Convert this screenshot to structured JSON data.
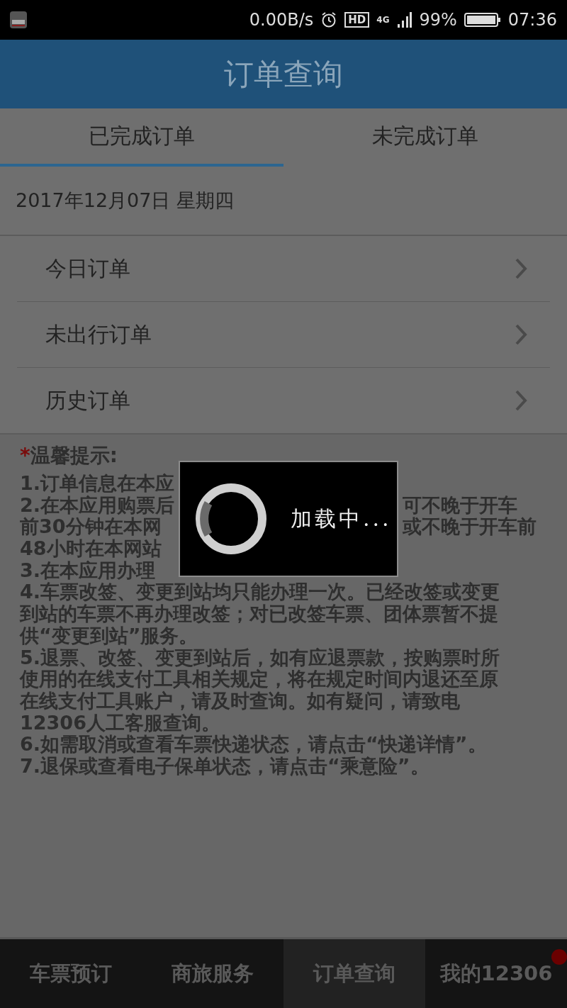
{
  "status_bar": {
    "speed": "0.00B/s",
    "hd": "HD",
    "network": "4G",
    "battery": "99%",
    "time": "07:36"
  },
  "header": {
    "title": "订单查询"
  },
  "tabs": [
    {
      "label": "已完成订单",
      "selected": true
    },
    {
      "label": "未完成订单",
      "selected": false
    }
  ],
  "date": "2017年12月07日 星期四",
  "menu": [
    {
      "label": "今日订单"
    },
    {
      "label": "未出行订单"
    },
    {
      "label": "历史订单"
    }
  ],
  "notice": {
    "mark": "*",
    "title": "温馨提示:",
    "lines": [
      {
        "kind": "split",
        "left": "1.订单信息在本应"
      },
      {
        "kind": "split",
        "left": "2.在本应用购票后",
        "right": "可不晚于开车"
      },
      {
        "kind": "split",
        "left": "前30分钟在本网",
        "right": "或不晚于开车前"
      },
      {
        "kind": "split",
        "left": "48小时在本网站"
      },
      {
        "kind": "split",
        "left": "3.在本应用办理"
      },
      {
        "kind": "full",
        "text": "4.车票改签、变更到站均只能办理一次。已经改签或变更"
      },
      {
        "kind": "full",
        "text": "到站的车票不再办理改签；对已改签车票、团体票暂不提"
      },
      {
        "kind": "full",
        "text": "供“变更到站”服务。"
      },
      {
        "kind": "full",
        "text": "5.退票、改签、变更到站后，如有应退票款，按购票时所"
      },
      {
        "kind": "full",
        "text": "使用的在线支付工具相关规定，将在规定时间内退还至原"
      },
      {
        "kind": "full",
        "text": "在线支付工具账户，请及时查询。如有疑问，请致电"
      },
      {
        "kind": "full",
        "text": "12306人工客服查询。"
      },
      {
        "kind": "full",
        "text": "6.如需取消或查看车票快递状态，请点击“快递详情”。"
      },
      {
        "kind": "full",
        "text": "7.退保或查看电子保单状态，请点击“乘意险”。"
      }
    ]
  },
  "loading": {
    "text": "加载中..."
  },
  "bottom_nav": [
    {
      "label": "车票预订",
      "selected": false,
      "dot": false
    },
    {
      "label": "商旅服务",
      "selected": false,
      "dot": false
    },
    {
      "label": "订单查询",
      "selected": true,
      "dot": false
    },
    {
      "label": "我的12306",
      "selected": false,
      "dot": true
    }
  ]
}
